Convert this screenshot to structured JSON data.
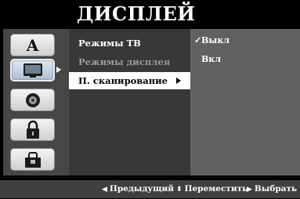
{
  "header": {
    "title": "ДИСПЛЕЙ"
  },
  "sidebar": {
    "icons": [
      {
        "name": "language-icon",
        "glyph": "A"
      },
      {
        "name": "display-icon",
        "glyph": "",
        "selected": true
      },
      {
        "name": "audio-icon",
        "glyph": ""
      },
      {
        "name": "lock-icon",
        "glyph": ""
      },
      {
        "name": "other-settings-icon",
        "glyph": ""
      }
    ]
  },
  "menu": {
    "items": [
      {
        "label": "Режимы ТВ",
        "state": "normal"
      },
      {
        "label": "Режимы дисплея",
        "state": "dim"
      },
      {
        "label": "П. сканирование",
        "state": "active"
      }
    ]
  },
  "options": {
    "items": [
      {
        "label": "Выкл",
        "checked": true,
        "check_glyph": "✓"
      },
      {
        "label": "Вкл",
        "checked": false
      }
    ]
  },
  "footer": {
    "prev": "Предыдущий",
    "move": "Переместить",
    "select": "Выбрать"
  },
  "colors": {
    "background": "#000000",
    "panel": "#575757",
    "menu": "#383838",
    "options": "#616161",
    "highlight": "#ffffff",
    "footer": "#404040"
  }
}
